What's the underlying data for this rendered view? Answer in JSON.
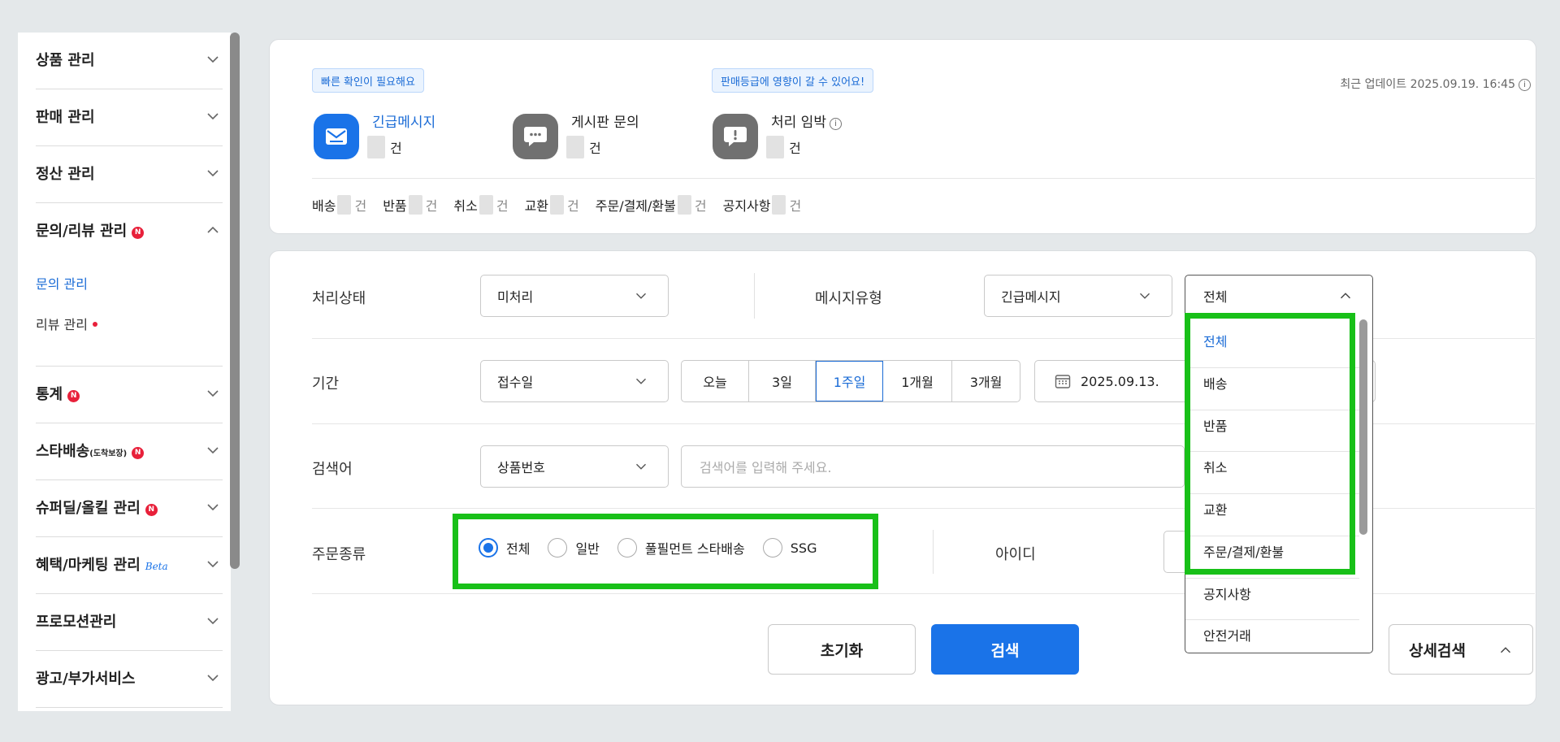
{
  "sidebar": {
    "menus": [
      {
        "label": "상품 관리"
      },
      {
        "label": "판매 관리"
      },
      {
        "label": "정산 관리"
      },
      {
        "label": "문의/리뷰 관리",
        "badge": "N"
      },
      {
        "label": "통계",
        "badge": "N"
      },
      {
        "label": "스타배송",
        "small": "(도착보장)",
        "badge": "N"
      },
      {
        "label": "슈퍼딜/올킬 관리",
        "badge": "N"
      },
      {
        "label": "혜택/마케팅 관리",
        "beta": "Beta"
      },
      {
        "label": "프로모션관리"
      },
      {
        "label": "광고/부가서비스"
      }
    ],
    "submenus": {
      "inquiry": "문의 관리",
      "review": "리뷰 관리"
    }
  },
  "top": {
    "pill_quick": "빠른 확인이 필요해요",
    "pill_grade": "판매등급에 영향이 갈 수 있어요!",
    "updated": "최근 업데이트 2025.09.19. 16:45",
    "info_mark": "i",
    "cards": [
      {
        "title": "긴급메시지",
        "unit": "건",
        "icon": "mail-icon"
      },
      {
        "title": "게시판 문의",
        "unit": "건",
        "icon": "chat-bubble-icon"
      },
      {
        "title": "처리 임박",
        "unit": "건",
        "icon": "alert-bubble-icon"
      }
    ],
    "stats": [
      {
        "label": "배송",
        "unit": "건"
      },
      {
        "label": "반품",
        "unit": "건"
      },
      {
        "label": "취소",
        "unit": "건"
      },
      {
        "label": "교환",
        "unit": "건"
      },
      {
        "label": "주문/결제/환불",
        "unit": "건"
      },
      {
        "label": "공지사항",
        "unit": "건"
      }
    ]
  },
  "form": {
    "status_label": "처리상태",
    "status_value": "미처리",
    "msgtype_label": "메시지유형",
    "msgtype_value": "긴급메시지",
    "sub_value": "전체",
    "period_label": "기간",
    "period_value": "접수일",
    "ranges": [
      "오늘",
      "3일",
      "1주일",
      "1개월",
      "3개월"
    ],
    "active_range": "1주일",
    "date_value": "2025.09.13.",
    "keyword_label": "검색어",
    "keyword_type": "상품번호",
    "keyword_placeholder": "검색어를 입력해 주세요.",
    "ordertype_label": "주문종류",
    "ordertypes": [
      "전체",
      "일반",
      "풀필먼트 스타배송",
      "SSG"
    ],
    "ordertype_selected": "전체",
    "id_label": "아이디",
    "reset": "초기화",
    "search": "검색",
    "detail": "상세검색"
  },
  "dropdown": {
    "options": [
      "전체",
      "배송",
      "반품",
      "취소",
      "교환",
      "주문/결제/환불",
      "공지사항",
      "안전거래"
    ],
    "selected": "전체"
  },
  "colors": {
    "accent": "#1a73e8",
    "badge": "#e8203a",
    "highlight": "#18c018"
  }
}
